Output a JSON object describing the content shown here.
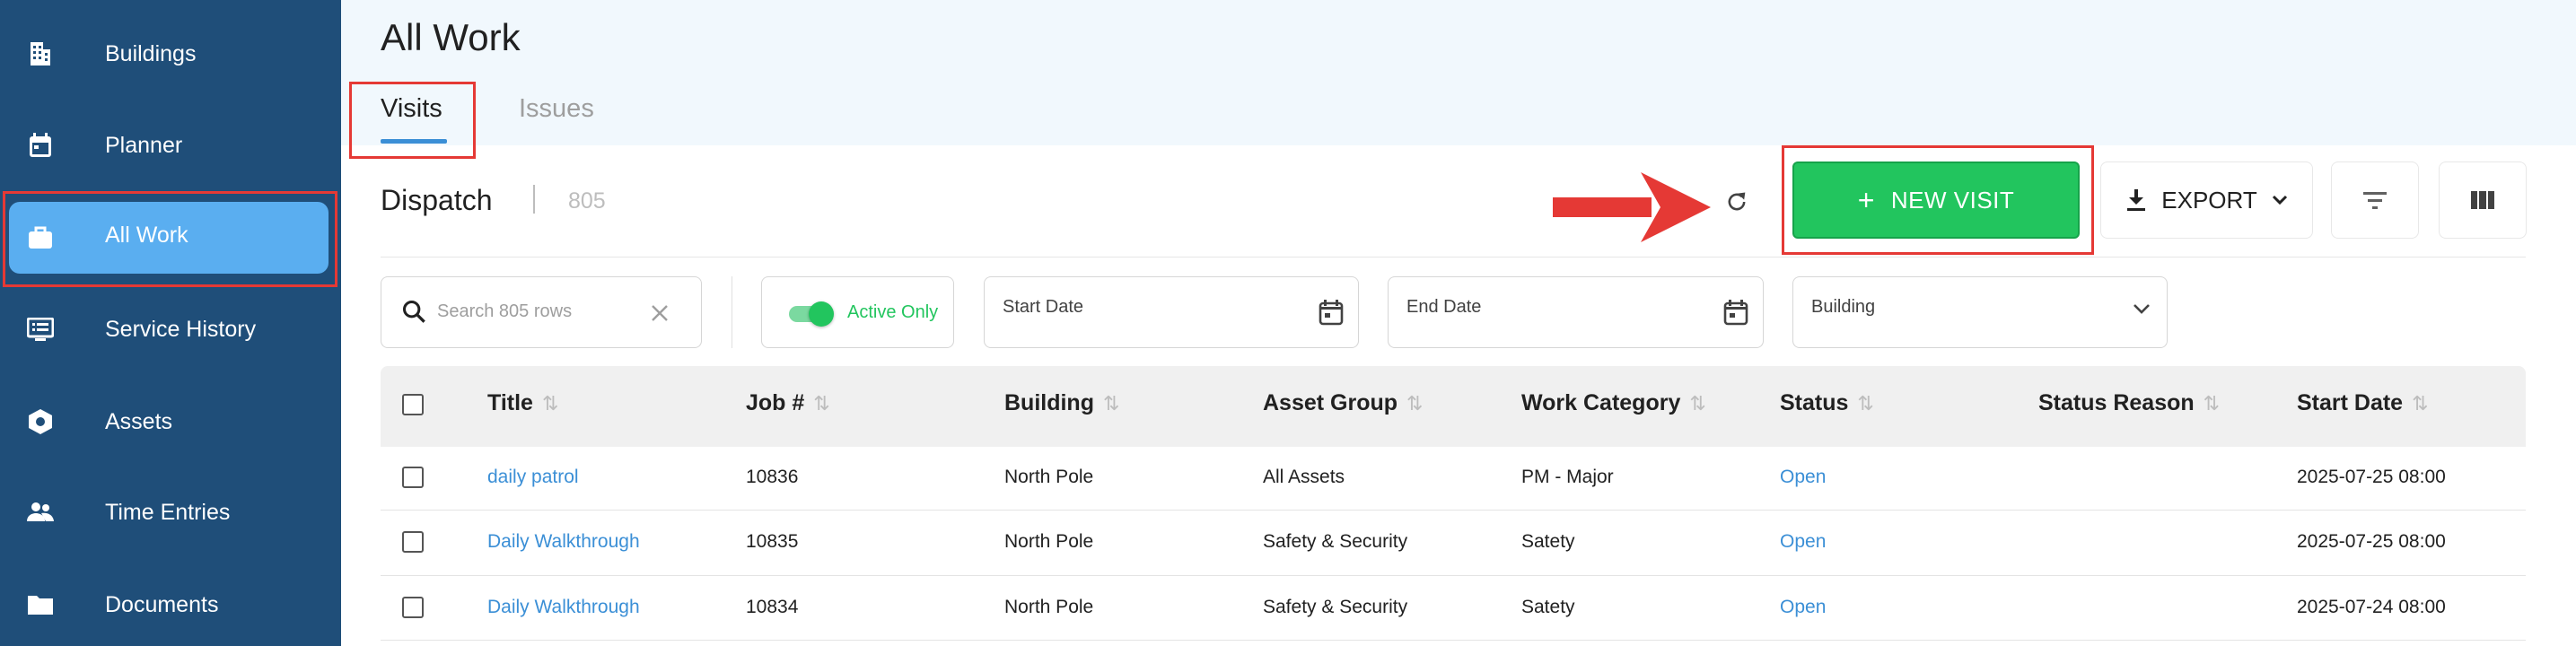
{
  "sidebar": {
    "items": [
      {
        "label": "Buildings",
        "icon": "building-icon"
      },
      {
        "label": "Planner",
        "icon": "calendar-icon"
      },
      {
        "label": "All Work",
        "icon": "briefcase-icon",
        "active": true
      },
      {
        "label": "Service History",
        "icon": "list-icon"
      },
      {
        "label": "Assets",
        "icon": "hexagon-icon"
      },
      {
        "label": "Time Entries",
        "icon": "people-icon"
      },
      {
        "label": "Documents",
        "icon": "folder-icon"
      }
    ]
  },
  "header": {
    "title": "All Work",
    "tabs": [
      {
        "label": "Visits",
        "active": true
      },
      {
        "label": "Issues",
        "active": false
      }
    ]
  },
  "toolbar": {
    "title": "Dispatch",
    "count": "805",
    "new_visit_label": "NEW VISIT",
    "export_label": "EXPORT"
  },
  "filters": {
    "search_placeholder": "Search 805 rows",
    "active_only_label": "Active Only",
    "active_only_enabled": true,
    "start_date_label": "Start Date",
    "end_date_label": "End Date",
    "building_label": "Building"
  },
  "table": {
    "columns": [
      "Title",
      "Job #",
      "Building",
      "Asset Group",
      "Work Category",
      "Status",
      "Status Reason",
      "Start Date"
    ],
    "rows": [
      {
        "title": "daily patrol",
        "job": "10836",
        "building": "North Pole",
        "asset_group": "All Assets",
        "work_category": "PM - Major",
        "status": "Open",
        "status_reason": "",
        "start_date": "2025-07-25 08:00"
      },
      {
        "title": "Daily Walkthrough",
        "job": "10835",
        "building": "North Pole",
        "asset_group": "Safety & Security",
        "work_category": "Satety",
        "status": "Open",
        "status_reason": "",
        "start_date": "2025-07-25 08:00"
      },
      {
        "title": "Daily Walkthrough",
        "job": "10834",
        "building": "North Pole",
        "asset_group": "Safety & Security",
        "work_category": "Satety",
        "status": "Open",
        "status_reason": "",
        "start_date": "2025-07-24 08:00"
      }
    ]
  },
  "colors": {
    "sidebar_bg": "#1f4e79",
    "sidebar_active": "#5aaef0",
    "accent_blue": "#3b8fd6",
    "primary_green": "#22c55e",
    "highlight_red": "#e53935"
  }
}
